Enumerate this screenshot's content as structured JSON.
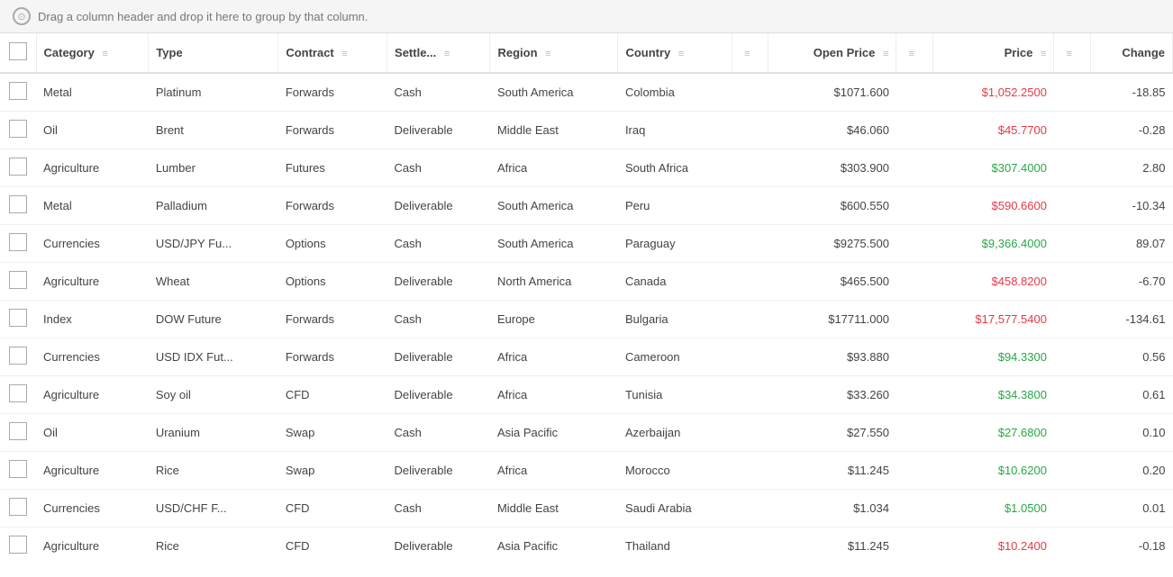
{
  "dragHint": {
    "text": "Drag a column header and drop it here to group by that column."
  },
  "columns": [
    {
      "id": "checkbox",
      "label": "",
      "filterable": false
    },
    {
      "id": "category",
      "label": "Category",
      "filterable": true
    },
    {
      "id": "type",
      "label": "Type",
      "filterable": false
    },
    {
      "id": "contract",
      "label": "Contract",
      "filterable": true
    },
    {
      "id": "settle",
      "label": "Settle...",
      "filterable": true
    },
    {
      "id": "region",
      "label": "Region",
      "filterable": true
    },
    {
      "id": "country",
      "label": "Country",
      "filterable": true
    },
    {
      "id": "extra",
      "label": "",
      "filterable": true
    },
    {
      "id": "openPrice",
      "label": "Open Price",
      "filterable": true
    },
    {
      "id": "extra2",
      "label": "",
      "filterable": true
    },
    {
      "id": "price",
      "label": "Price",
      "filterable": true
    },
    {
      "id": "extra3",
      "label": "",
      "filterable": true
    },
    {
      "id": "change",
      "label": "Change",
      "filterable": false
    }
  ],
  "rows": [
    {
      "category": "Metal",
      "type": "Platinum",
      "contract": "Forwards",
      "settle": "Cash",
      "region": "South America",
      "country": "Colombia",
      "openPrice": "$1071.600",
      "price": "$1,052.2500",
      "priceDir": "down",
      "change": "-18.85"
    },
    {
      "category": "Oil",
      "type": "Brent",
      "contract": "Forwards",
      "settle": "Deliverable",
      "region": "Middle East",
      "country": "Iraq",
      "openPrice": "$46.060",
      "price": "$45.7700",
      "priceDir": "down",
      "change": "-0.28"
    },
    {
      "category": "Agriculture",
      "type": "Lumber",
      "contract": "Futures",
      "settle": "Cash",
      "region": "Africa",
      "country": "South Africa",
      "openPrice": "$303.900",
      "price": "$307.4000",
      "priceDir": "up",
      "change": "2.80"
    },
    {
      "category": "Metal",
      "type": "Palladium",
      "contract": "Forwards",
      "settle": "Deliverable",
      "region": "South America",
      "country": "Peru",
      "openPrice": "$600.550",
      "price": "$590.6600",
      "priceDir": "down",
      "change": "-10.34"
    },
    {
      "category": "Currencies",
      "type": "USD/JPY Fu...",
      "contract": "Options",
      "settle": "Cash",
      "region": "South America",
      "country": "Paraguay",
      "openPrice": "$9275.500",
      "price": "$9,366.4000",
      "priceDir": "up",
      "change": "89.07"
    },
    {
      "category": "Agriculture",
      "type": "Wheat",
      "contract": "Options",
      "settle": "Deliverable",
      "region": "North America",
      "country": "Canada",
      "openPrice": "$465.500",
      "price": "$458.8200",
      "priceDir": "down",
      "change": "-6.70"
    },
    {
      "category": "Index",
      "type": "DOW Future",
      "contract": "Forwards",
      "settle": "Cash",
      "region": "Europe",
      "country": "Bulgaria",
      "openPrice": "$17711.000",
      "price": "$17,577.5400",
      "priceDir": "down",
      "change": "-134.61"
    },
    {
      "category": "Currencies",
      "type": "USD IDX Fut...",
      "contract": "Forwards",
      "settle": "Deliverable",
      "region": "Africa",
      "country": "Cameroon",
      "openPrice": "$93.880",
      "price": "$94.3300",
      "priceDir": "up",
      "change": "0.56"
    },
    {
      "category": "Agriculture",
      "type": "Soy oil",
      "contract": "CFD",
      "settle": "Deliverable",
      "region": "Africa",
      "country": "Tunisia",
      "openPrice": "$33.260",
      "price": "$34.3800",
      "priceDir": "up",
      "change": "0.61"
    },
    {
      "category": "Oil",
      "type": "Uranium",
      "contract": "Swap",
      "settle": "Cash",
      "region": "Asia Pacific",
      "country": "Azerbaijan",
      "openPrice": "$27.550",
      "price": "$27.6800",
      "priceDir": "up",
      "change": "0.10"
    },
    {
      "category": "Agriculture",
      "type": "Rice",
      "contract": "Swap",
      "settle": "Deliverable",
      "region": "Africa",
      "country": "Morocco",
      "openPrice": "$11.245",
      "price": "$10.6200",
      "priceDir": "up",
      "change": "0.20"
    },
    {
      "category": "Currencies",
      "type": "USD/CHF F...",
      "contract": "CFD",
      "settle": "Cash",
      "region": "Middle East",
      "country": "Saudi Arabia",
      "openPrice": "$1.034",
      "price": "$1.0500",
      "priceDir": "up",
      "change": "0.01"
    },
    {
      "category": "Agriculture",
      "type": "Rice",
      "contract": "CFD",
      "settle": "Deliverable",
      "region": "Asia Pacific",
      "country": "Thailand",
      "openPrice": "$11.245",
      "price": "$10.2400",
      "priceDir": "down",
      "change": "-0.18"
    }
  ]
}
